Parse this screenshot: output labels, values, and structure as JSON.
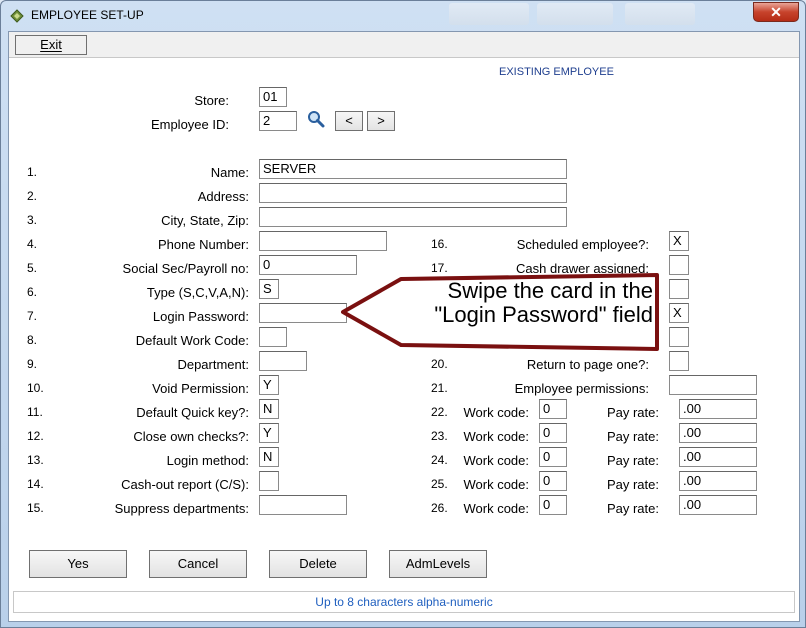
{
  "window": {
    "title": "EMPLOYEE SET-UP",
    "close_glyph": "✕"
  },
  "toolbar": {
    "exit_label": "Exit"
  },
  "mode_label": "EXISTING EMPLOYEE",
  "store": {
    "label": "Store:",
    "value": "01"
  },
  "employee_id": {
    "label": "Employee ID:",
    "value": "2",
    "prev_label": "<",
    "next_label": ">"
  },
  "left_fields": [
    {
      "num": "1.",
      "label": "Name:",
      "value": "SERVER"
    },
    {
      "num": "2.",
      "label": "Address:",
      "value": ""
    },
    {
      "num": "3.",
      "label": "City, State, Zip:",
      "value": ""
    },
    {
      "num": "4.",
      "label": "Phone Number:",
      "value": ""
    },
    {
      "num": "5.",
      "label": "Social Sec/Payroll no:",
      "value": "0"
    },
    {
      "num": "6.",
      "label": "Type (S,C,V,A,N):",
      "value": "S"
    },
    {
      "num": "7.",
      "label": "Login Password:",
      "value": ""
    },
    {
      "num": "8.",
      "label": "Default Work Code:",
      "value": ""
    },
    {
      "num": "9.",
      "label": "Department:",
      "value": ""
    },
    {
      "num": "10.",
      "label": "Void Permission:",
      "value": "Y"
    },
    {
      "num": "11.",
      "label": "Default Quick key?:",
      "value": "N"
    },
    {
      "num": "12.",
      "label": "Close own checks?:",
      "value": "Y"
    },
    {
      "num": "13.",
      "label": "Login method:",
      "value": "N"
    },
    {
      "num": "14.",
      "label": "Cash-out report (C/S):",
      "value": ""
    },
    {
      "num": "15.",
      "label": "Suppress departments:",
      "value": ""
    }
  ],
  "right_fields": [
    {
      "num": "16.",
      "label": "Scheduled employee?:",
      "value": "X"
    },
    {
      "num": "17.",
      "label": "Cash drawer assigned:",
      "value": ""
    },
    {
      "num": "",
      "label": "",
      "value": ""
    },
    {
      "num": "",
      "label": "",
      "value": "X"
    },
    {
      "num": "",
      "label": "",
      "value": ""
    },
    {
      "num": "20.",
      "label": "Return to page one?:",
      "value": ""
    },
    {
      "num": "21.",
      "label": "Employee permissions:",
      "value": ""
    }
  ],
  "work_codes": {
    "work_code_label": "Work code:",
    "pay_rate_label": "Pay rate:",
    "rows": [
      {
        "num": "22.",
        "code": "0",
        "rate": ".00"
      },
      {
        "num": "23.",
        "code": "0",
        "rate": ".00"
      },
      {
        "num": "24.",
        "code": "0",
        "rate": ".00"
      },
      {
        "num": "25.",
        "code": "0",
        "rate": ".00"
      },
      {
        "num": "26.",
        "code": "0",
        "rate": ".00"
      }
    ]
  },
  "buttons": {
    "yes": "Yes",
    "cancel": "Cancel",
    "delete": "Delete",
    "admlevels": "AdmLevels"
  },
  "status_text": "Up to 8 characters alpha-numeric",
  "callout": {
    "line1": "Swipe the card in the",
    "line2": "\"Login Password\" field"
  },
  "colors": {
    "callout_border": "#7a1010",
    "status_text": "#1f5fbf",
    "mode_label": "#1f3f8f"
  }
}
